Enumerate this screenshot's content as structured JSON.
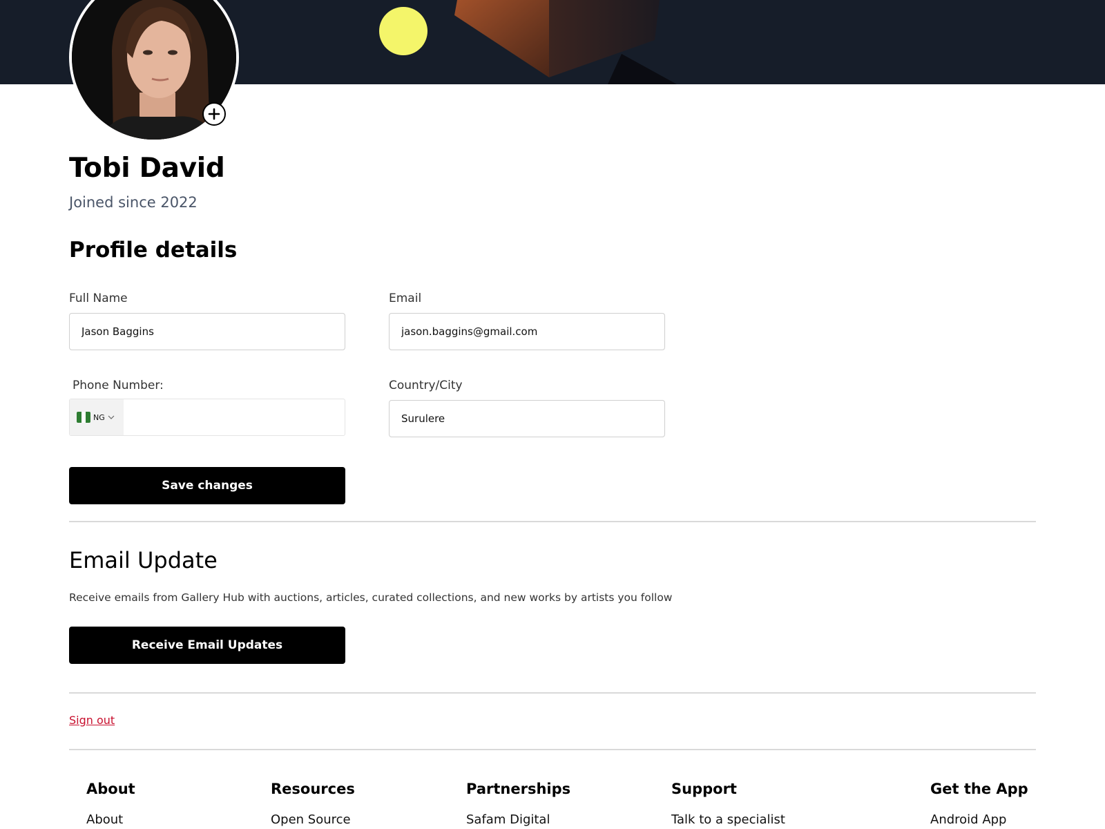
{
  "profile": {
    "name": "Tobi David",
    "joined": "Joined since 2022"
  },
  "profile_details": {
    "title": "Profile details",
    "full_name_label": "Full Name",
    "full_name_value": "Jason Baggins",
    "email_label": "Email",
    "email_value": "jason.baggins@gmail.com",
    "phone_label": "Phone Number:",
    "phone_country_code": "NG",
    "phone_value": "",
    "country_label": "Country/City",
    "country_value": "Surulere",
    "save_label": "Save changes"
  },
  "email_update": {
    "title": "Email Update",
    "description": "Receive emails from Gallery Hub with auctions, articles, curated collections, and new works by artists you follow",
    "button_label": "Receive Email Updates"
  },
  "signout_label": "Sign out",
  "footer": {
    "columns": [
      {
        "heading": "About",
        "link": "About"
      },
      {
        "heading": "Resources",
        "link": "Open Source"
      },
      {
        "heading": "Partnerships",
        "link": "Safam Digital"
      },
      {
        "heading": "Support",
        "link": "Talk to a specialist"
      },
      {
        "heading": "Get the App",
        "link": "Android App"
      }
    ]
  },
  "colors": {
    "banner": "#161d29",
    "accent_button": "#000000",
    "signout": "#c8102e",
    "flag_green": "#2e7d32"
  },
  "icons": {
    "avatar_add": "plus-circle-icon",
    "country_dropdown": "chevron-down-icon"
  }
}
